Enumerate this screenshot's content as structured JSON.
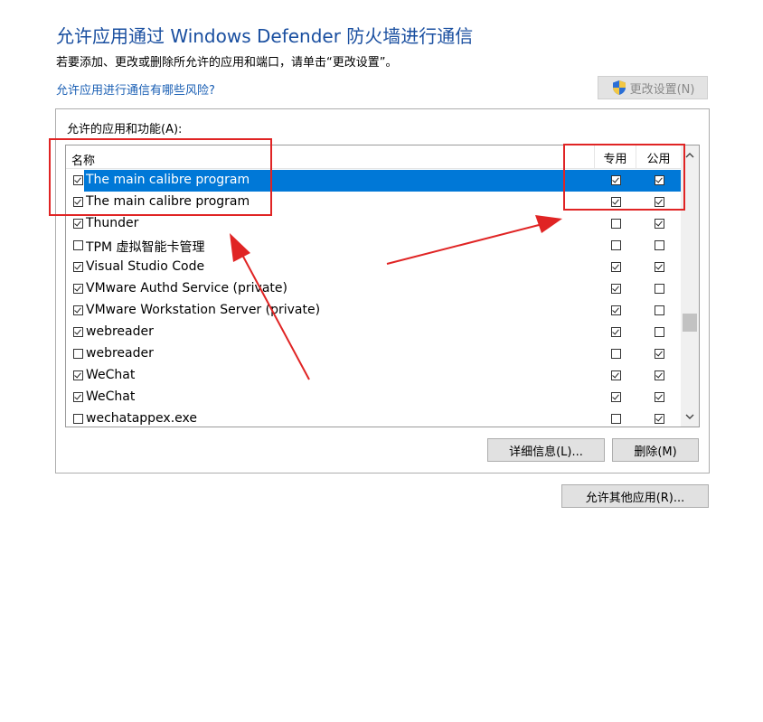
{
  "title": "允许应用通过 Windows Defender 防火墙进行通信",
  "subtitle": "若要添加、更改或删除所允许的应用和端口，请单击“更改设置”。",
  "risk_link": "允许应用进行通信有哪些风险?",
  "change_settings_button": "更改设置(N)",
  "group_label": "允许的应用和功能(A):",
  "columns": {
    "name": "名称",
    "private": "专用",
    "public": "公用"
  },
  "rows": [
    {
      "name": "The main calibre program",
      "enabled": true,
      "private": true,
      "public": true,
      "selected": true
    },
    {
      "name": "The main calibre program",
      "enabled": true,
      "private": true,
      "public": true,
      "selected": false
    },
    {
      "name": "Thunder",
      "enabled": true,
      "private": false,
      "public": true,
      "selected": false
    },
    {
      "name": "TPM 虚拟智能卡管理",
      "enabled": false,
      "private": false,
      "public": false,
      "selected": false
    },
    {
      "name": "Visual Studio Code",
      "enabled": true,
      "private": true,
      "public": true,
      "selected": false
    },
    {
      "name": "VMware Authd Service (private)",
      "enabled": true,
      "private": true,
      "public": false,
      "selected": false
    },
    {
      "name": "VMware Workstation Server (private)",
      "enabled": true,
      "private": true,
      "public": false,
      "selected": false
    },
    {
      "name": "webreader",
      "enabled": true,
      "private": true,
      "public": false,
      "selected": false
    },
    {
      "name": "webreader",
      "enabled": false,
      "private": false,
      "public": true,
      "selected": false
    },
    {
      "name": "WeChat",
      "enabled": true,
      "private": true,
      "public": true,
      "selected": false
    },
    {
      "name": "WeChat",
      "enabled": true,
      "private": true,
      "public": true,
      "selected": false
    },
    {
      "name": "wechatappex.exe",
      "enabled": false,
      "private": false,
      "public": true,
      "selected": false
    }
  ],
  "details_button": "详细信息(L)...",
  "delete_button": "删除(M)",
  "allow_other_button": "允许其他应用(R)...",
  "icons": {
    "shield": "uac-shield-icon",
    "scroll_up": "chevron-up-icon",
    "scroll_down": "chevron-down-icon"
  },
  "colors": {
    "title": "#1a4fa0",
    "link": "#1a5fb4",
    "selection": "#0078d7",
    "annotation": "#e02424"
  }
}
